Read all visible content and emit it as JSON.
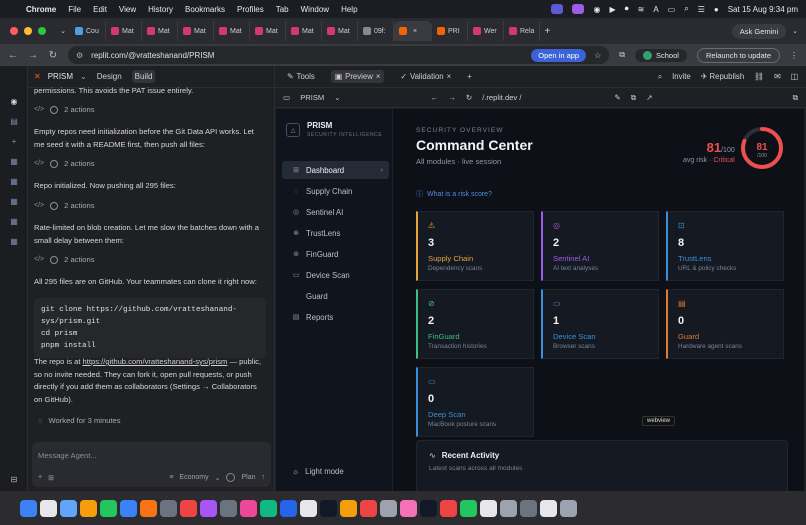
{
  "menubar": {
    "app": "Chrome",
    "items": [
      "File",
      "Edit",
      "View",
      "History",
      "Bookmarks",
      "Profiles",
      "Tab",
      "Window",
      "Help"
    ],
    "datetime": "Sat 15 Aug  9:34 pm"
  },
  "tabs": {
    "items": [
      {
        "label": "Cou",
        "color": "#4aa3df"
      },
      {
        "label": "Mat",
        "color": "#d23a6d"
      },
      {
        "label": "Mat",
        "color": "#d23a6d"
      },
      {
        "label": "Mat",
        "color": "#d23a6d"
      },
      {
        "label": "Mat",
        "color": "#d23a6d"
      },
      {
        "label": "Mat",
        "color": "#d23a6d"
      },
      {
        "label": "Mat",
        "color": "#d23a6d"
      },
      {
        "label": "Mat",
        "color": "#d23a6d"
      },
      {
        "label": "09f:",
        "color": "#8a8a8a"
      },
      {
        "label": "",
        "color": "#f26207"
      },
      {
        "label": "PRI",
        "color": "#f26207"
      },
      {
        "label": "Wer",
        "color": "#d23a6d"
      },
      {
        "label": "Rela",
        "color": "#d23a6d"
      }
    ],
    "ask_gemini": "Ask Gemini"
  },
  "address": {
    "url": "replit.com/@vratteshanand/PRISM",
    "open_in_app": "Open in app",
    "profile": "School",
    "relaunch": "Relaunch to update"
  },
  "left_panel": {
    "project": "PRISM",
    "design_label": "Design",
    "build_label": "Build",
    "msg0": "permissions. This avoids the PAT issue entirely.",
    "actions_label": "2 actions",
    "msg1": "Empty repos need initialization before the Git Data API works. Let me seed it with a README first, then push all files:",
    "msg2": "Repo initialized. Now pushing all 295 files:",
    "msg3": "Rate-limited on blob creation. Let me slow the batches down with a small delay between them:",
    "msg4": "All 295 files are on GitHub. Your teammates can clone it right now:",
    "code": "git clone https://github.com/vratteshanand-\nsys/prism.git\ncd prism\npnpm install",
    "msg5_pre": "The repo is at ",
    "msg5_link": "https://github.com/vratteshanand-sys/prism",
    "msg5_post": " — public, so no invite needed. They can fork it, open pull requests, or push directly if you add them as collaborators (Settings → Collaborators on GitHub).",
    "worked": "Worked for 3 minutes",
    "input_placeholder": "Message Agent...",
    "economy": "Economy",
    "plan": "Plan"
  },
  "right_pane": {
    "tabs": [
      "Tools",
      "Preview",
      "Validation"
    ],
    "invite": "Invite",
    "republish": "Republish",
    "app_name": "PRISM",
    "preview_url": "/.replit.dev /"
  },
  "prism": {
    "brand": "PRISM",
    "brand_sub": "SECURITY INTELLIGENCE",
    "nav": [
      "Dashboard",
      "Supply Chain",
      "Sentinel AI",
      "TrustLens",
      "FinGuard",
      "Device Scan",
      "Guard",
      "Reports"
    ],
    "light_mode": "Light mode",
    "eyebrow": "SECURITY OVERVIEW",
    "title": "Command Center",
    "subtitle": "All modules · live session",
    "score": "81",
    "score_of": "/100",
    "score_caption": "avg risk · ",
    "score_level": "Critical",
    "ring_value": "81",
    "ring_of": "/100",
    "ring_fraction": 0.81,
    "risk_question": "What is a risk score?",
    "cards": [
      {
        "value": "3",
        "name": "Supply Chain",
        "desc": "Dependency scans",
        "color": "#e8a23a",
        "icon": "⚠"
      },
      {
        "value": "2",
        "name": "Sentinel AI",
        "desc": "AI text analyses",
        "color": "#9b5de5",
        "icon": "◎"
      },
      {
        "value": "8",
        "name": "TrustLens",
        "desc": "URL & policy checks",
        "color": "#3a8fd8",
        "icon": "⊡"
      },
      {
        "value": "2",
        "name": "FinGuard",
        "desc": "Transaction histories",
        "color": "#3fbf7f",
        "icon": "⊘"
      },
      {
        "value": "1",
        "name": "Device Scan",
        "desc": "Browser scans",
        "color": "#3a8fd8",
        "icon": "▭"
      },
      {
        "value": "0",
        "name": "Guard",
        "desc": "Hardware agent scans",
        "color": "#e07a2e",
        "icon": "▤"
      },
      {
        "value": "0",
        "name": "Deep Scan",
        "desc": "MacBook posture scans",
        "color": "#3a8fd8",
        "icon": "▭"
      }
    ],
    "webview_tag": "webview",
    "recent_title": "Recent Activity",
    "recent_sub": "Latest scans across all modules"
  },
  "dock": {
    "colors": [
      "#3b82f6",
      "#e5e7eb",
      "#60a5fa",
      "#f59e0b",
      "#22c55e",
      "#3b82f6",
      "#f97316",
      "#6b7280",
      "#ef4444",
      "#a855f7",
      "#6b7280",
      "#ec4899",
      "#10b981",
      "#2563eb",
      "#e5e7eb",
      "#111827",
      "#f59e0b",
      "#ef4444",
      "#9ca3af",
      "#f472b6",
      "#111827",
      "#ef4444",
      "#22c55e",
      "#e5e7eb",
      "#9ca3af",
      "#6b7280",
      "#e5e7eb",
      "#9ca3af"
    ]
  }
}
